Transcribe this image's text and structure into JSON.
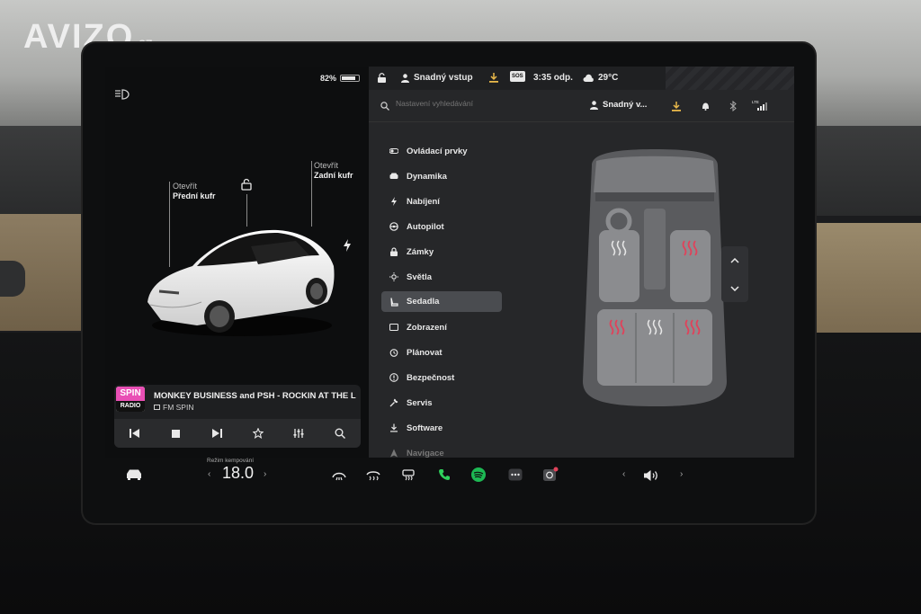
{
  "watermark": {
    "brand": "AVIZO",
    "tld": ".cz"
  },
  "status": {
    "battery_percent": "82%",
    "battery_level": 0.82,
    "driver_profile": "Snadný vstup",
    "sos": "SOS",
    "time": "3:35 odp.",
    "temperature": "29°C"
  },
  "car_view": {
    "front_trunk": {
      "action": "Otevřít",
      "name": "Přední kufr"
    },
    "rear_trunk": {
      "action": "Otevřít",
      "name": "Zadní kufr"
    }
  },
  "media": {
    "logo_top": "SPIN",
    "logo_bottom": "RADIO",
    "song": "MONKEY BUSINESS and PSH - ROCKIN AT THE L",
    "station": "FM SPIN",
    "controls": [
      "previous-icon",
      "stop-icon",
      "next-icon",
      "star-icon",
      "equalizer-icon",
      "search-icon"
    ]
  },
  "search": {
    "placeholder": "Nastavení vyhledávání"
  },
  "profile": {
    "name": "Snadný v..."
  },
  "menu": {
    "items": [
      {
        "label": "Ovládací prvky",
        "icon": "toggle-icon"
      },
      {
        "label": "Dynamika",
        "icon": "car-icon"
      },
      {
        "label": "Nabíjení",
        "icon": "bolt-icon"
      },
      {
        "label": "Autopilot",
        "icon": "steering-wheel-icon"
      },
      {
        "label": "Zámky",
        "icon": "lock-icon"
      },
      {
        "label": "Světla",
        "icon": "sun-icon"
      },
      {
        "label": "Sedadla",
        "icon": "seat-icon",
        "active": true
      },
      {
        "label": "Zobrazení",
        "icon": "display-icon"
      },
      {
        "label": "Plánovat",
        "icon": "alarm-clock-icon"
      },
      {
        "label": "Bezpečnost",
        "icon": "info-icon"
      },
      {
        "label": "Servis",
        "icon": "wrench-icon"
      },
      {
        "label": "Software",
        "icon": "download-icon"
      },
      {
        "label": "Navigace",
        "icon": "navigation-icon"
      }
    ]
  },
  "seat_heaters": {
    "driver": "off",
    "passenger": "on",
    "rear_left": "on",
    "rear_center": "off",
    "rear_right": "on"
  },
  "bottom_bar": {
    "climate_mode": "Režim kempování",
    "temperature": "18.0"
  },
  "colors": {
    "heat_on": "#e0425a",
    "heat_off": "#e6e6e6",
    "spotify": "#1db954",
    "phone": "#2fd05c",
    "download": "#e8b84a"
  }
}
